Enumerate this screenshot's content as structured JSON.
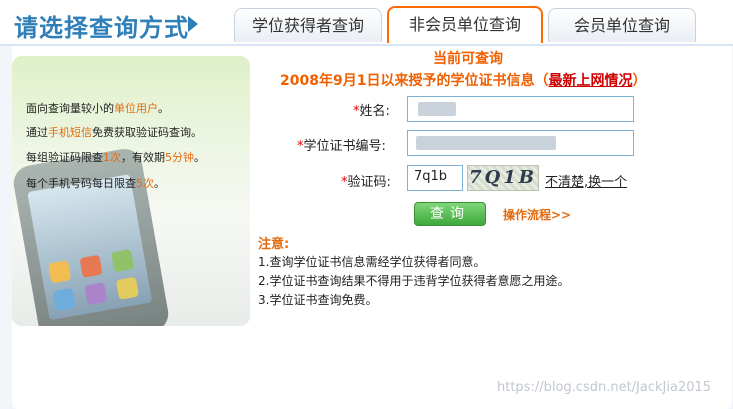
{
  "header": {
    "title": "请选择查询方式",
    "tabs": [
      {
        "label": "学位获得者查询",
        "active": false
      },
      {
        "label": "非会员单位查询",
        "active": true
      },
      {
        "label": "会员单位查询",
        "active": false
      }
    ]
  },
  "promo": {
    "line1_a": "面向查询量较小的",
    "line1_hl": "单位用户",
    "line1_b": "。",
    "line2_a": "通过",
    "line2_hl": "手机短信",
    "line2_b": "免费获取验证码查询。",
    "line3_a": "每组验证码限查",
    "line3_hl1": "1次",
    "line3_b": "，有效期",
    "line3_hl2": "5分钟",
    "line3_c": "。",
    "line4_a": "每个手机号码每日限查",
    "line4_hl": "5次",
    "line4_b": "。"
  },
  "form": {
    "heading1": "当前可查询",
    "heading2_text": "2008年9月1日以来授予的学位证书信息（",
    "heading2_link": "最新上网情况",
    "heading2_end": "）",
    "name_label": "姓名:",
    "cert_label": "学位证书编号:",
    "captcha_label": "验证码:",
    "required_mark": "*",
    "captcha_value": "7q1b",
    "captcha_image_text": "7Q1B",
    "refresh_link": "不清楚,换一个",
    "query_button": "查询",
    "flow_link": "操作流程>>"
  },
  "notes": {
    "title": "注意:",
    "items": [
      "1.查询学位证书信息需经学位获得者同意。",
      "2.学位证书查询结果不得用于违背学位获得者意愿之用途。",
      "3.学位证书查询免费。"
    ]
  },
  "watermark": "https://blog.csdn.net/JackJia2015",
  "colors": {
    "accent": "#f06000",
    "brand_blue": "#2f7fb8",
    "button_green": "#3ea83a"
  }
}
